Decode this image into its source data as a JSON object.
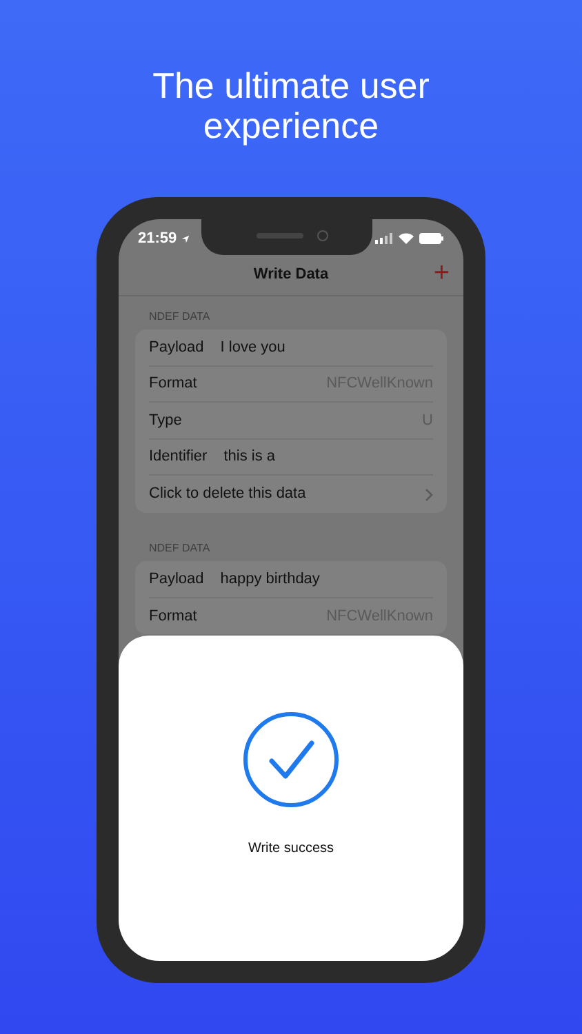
{
  "headline": "The ultimate user experience",
  "status_bar": {
    "time": "21:59"
  },
  "nav": {
    "title": "Write Data",
    "add": "+"
  },
  "sections": [
    {
      "header": "NDEF DATA",
      "rows": [
        {
          "kind": "field",
          "label": "Payload",
          "value": "I love you"
        },
        {
          "kind": "detail",
          "label": "Format",
          "value": "NFCWellKnown"
        },
        {
          "kind": "detail",
          "label": "Type",
          "value": "U"
        },
        {
          "kind": "field",
          "label": "Identifier",
          "value": "this is a"
        },
        {
          "kind": "action",
          "label": "Click to delete this data"
        }
      ]
    },
    {
      "header": "NDEF DATA",
      "rows": [
        {
          "kind": "field",
          "label": "Payload",
          "value": "happy birthday"
        },
        {
          "kind": "detail",
          "label": "Format",
          "value": "NFCWellKnown"
        }
      ]
    }
  ],
  "dialog": {
    "message": "Write success"
  }
}
